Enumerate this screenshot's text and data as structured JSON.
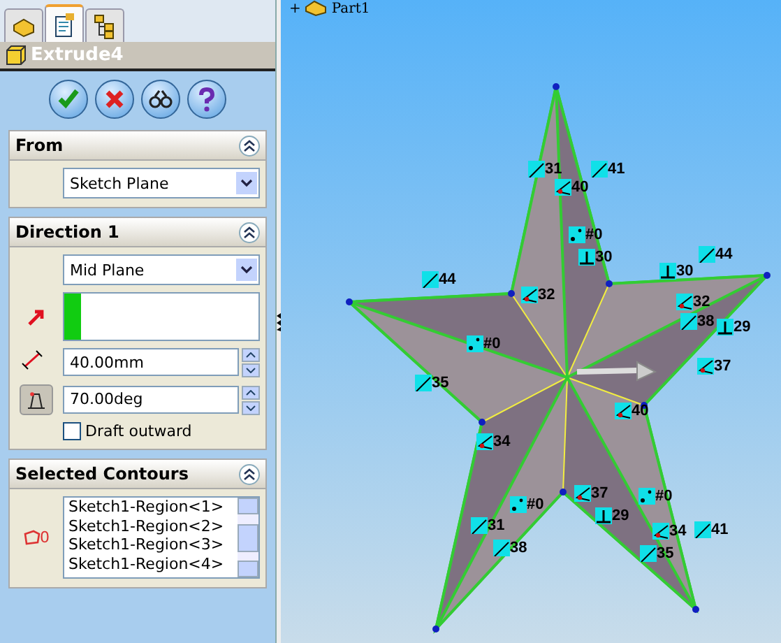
{
  "tabs": [
    {
      "kind": "feature-tree",
      "selected": false
    },
    {
      "kind": "property",
      "selected": true
    },
    {
      "kind": "configuration",
      "selected": false
    }
  ],
  "feature": {
    "title": "Extrude4"
  },
  "actions": [
    {
      "kind": "ok"
    },
    {
      "kind": "cancel"
    },
    {
      "kind": "preview"
    },
    {
      "kind": "help"
    }
  ],
  "from": {
    "title": "From",
    "end_condition": "Sketch Plane"
  },
  "direction": {
    "title": "Direction 1",
    "end_condition": "Mid Plane",
    "depth": "40.00mm",
    "draft_angle": "70.00deg",
    "draft_on": true,
    "draft_outward": {
      "label": "Draft outward",
      "checked": false
    }
  },
  "contours": {
    "title": "Selected Contours",
    "count": "0",
    "items": [
      "Sketch1-Region<1>",
      "Sketch1-Region<2>",
      "Sketch1-Region<3>",
      "Sketch1-Region<4>"
    ]
  },
  "tree": {
    "expander": "+",
    "label": "Part1"
  },
  "relations": [
    {
      "kind": "parallel",
      "label": "31"
    },
    {
      "kind": "parallel",
      "label": "41"
    },
    {
      "kind": "angle",
      "label": "40"
    },
    {
      "kind": "point",
      "label": "#0"
    },
    {
      "kind": "perpendicular",
      "label": "30"
    },
    {
      "kind": "parallel",
      "label": "44"
    },
    {
      "kind": "angle",
      "label": "32"
    },
    {
      "kind": "perpendicular",
      "label": "30"
    },
    {
      "kind": "parallel",
      "label": "44"
    },
    {
      "kind": "angle",
      "label": "32"
    },
    {
      "kind": "parallel",
      "label": "38"
    },
    {
      "kind": "perpendicular",
      "label": "29"
    },
    {
      "kind": "point",
      "label": "#0"
    },
    {
      "kind": "parallel",
      "label": "35"
    },
    {
      "kind": "angle",
      "label": "37"
    },
    {
      "kind": "angle",
      "label": "40"
    },
    {
      "kind": "angle",
      "label": "34"
    },
    {
      "kind": "angle",
      "label": "37"
    },
    {
      "kind": "point",
      "label": "#0"
    },
    {
      "kind": "point",
      "label": "#0"
    },
    {
      "kind": "perpendicular",
      "label": "29"
    },
    {
      "kind": "parallel",
      "label": "31"
    },
    {
      "kind": "angle",
      "label": "34"
    },
    {
      "kind": "parallel",
      "label": "41"
    },
    {
      "kind": "parallel",
      "label": "38"
    },
    {
      "kind": "parallel",
      "label": "35"
    }
  ]
}
